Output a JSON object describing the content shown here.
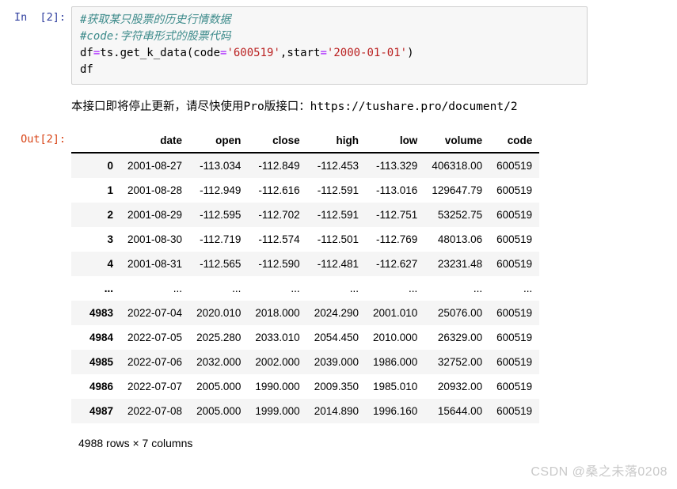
{
  "input_cell": {
    "prompt": "In  [2]:",
    "lines": [
      {
        "type": "comment",
        "text": "#获取某只股票的历史行情数据"
      },
      {
        "type": "comment",
        "text": "#code:字符串形式的股票代码"
      },
      {
        "type": "code",
        "segments": [
          {
            "cls": "plain",
            "text": "df"
          },
          {
            "cls": "op",
            "text": "="
          },
          {
            "cls": "plain",
            "text": "ts.get_k_data(code"
          },
          {
            "cls": "op",
            "text": "="
          },
          {
            "cls": "str",
            "text": "'600519'"
          },
          {
            "cls": "plain",
            "text": ",start"
          },
          {
            "cls": "op",
            "text": "="
          },
          {
            "cls": "str",
            "text": "'2000-01-01'"
          },
          {
            "cls": "plain",
            "text": ")"
          }
        ]
      },
      {
        "type": "code",
        "segments": [
          {
            "cls": "plain",
            "text": "df"
          }
        ]
      }
    ]
  },
  "stdout": {
    "message": "本接口即将停止更新，请尽快使用Pro版接口：https://tushare.pro/document/2"
  },
  "output_cell": {
    "prompt": "Out[2]:",
    "table": {
      "index_header": "",
      "columns": [
        "date",
        "open",
        "close",
        "high",
        "low",
        "volume",
        "code"
      ],
      "rows": [
        {
          "index": "0",
          "cells": [
            "2001-08-27",
            "-113.034",
            "-112.849",
            "-112.453",
            "-113.329",
            "406318.00",
            "600519"
          ]
        },
        {
          "index": "1",
          "cells": [
            "2001-08-28",
            "-112.949",
            "-112.616",
            "-112.591",
            "-113.016",
            "129647.79",
            "600519"
          ]
        },
        {
          "index": "2",
          "cells": [
            "2001-08-29",
            "-112.595",
            "-112.702",
            "-112.591",
            "-112.751",
            "53252.75",
            "600519"
          ]
        },
        {
          "index": "3",
          "cells": [
            "2001-08-30",
            "-112.719",
            "-112.574",
            "-112.501",
            "-112.769",
            "48013.06",
            "600519"
          ]
        },
        {
          "index": "4",
          "cells": [
            "2001-08-31",
            "-112.565",
            "-112.590",
            "-112.481",
            "-112.627",
            "23231.48",
            "600519"
          ]
        },
        {
          "index": "...",
          "cells": [
            "...",
            "...",
            "...",
            "...",
            "...",
            "...",
            "..."
          ]
        },
        {
          "index": "4983",
          "cells": [
            "2022-07-04",
            "2020.010",
            "2018.000",
            "2024.290",
            "2001.010",
            "25076.00",
            "600519"
          ]
        },
        {
          "index": "4984",
          "cells": [
            "2022-07-05",
            "2025.280",
            "2033.010",
            "2054.450",
            "2010.000",
            "26329.00",
            "600519"
          ]
        },
        {
          "index": "4985",
          "cells": [
            "2022-07-06",
            "2032.000",
            "2002.000",
            "2039.000",
            "1986.000",
            "32752.00",
            "600519"
          ]
        },
        {
          "index": "4986",
          "cells": [
            "2022-07-07",
            "2005.000",
            "1990.000",
            "2009.350",
            "1985.010",
            "20932.00",
            "600519"
          ]
        },
        {
          "index": "4987",
          "cells": [
            "2022-07-08",
            "2005.000",
            "1999.000",
            "2014.890",
            "1996.160",
            "15644.00",
            "600519"
          ]
        }
      ]
    },
    "shape_note": "4988 rows × 7 columns"
  },
  "watermark": {
    "text": "CSDN @桑之未落0208"
  },
  "colors": {
    "prompt_in": "#303f9f",
    "prompt_out": "#d84315",
    "comment": "#3d8b8b",
    "string": "#ba2121",
    "operator": "#aa22ff",
    "cell_bg": "#f7f7f7",
    "row_stripe": "#f5f5f5",
    "watermark": "#c9c9c9"
  }
}
